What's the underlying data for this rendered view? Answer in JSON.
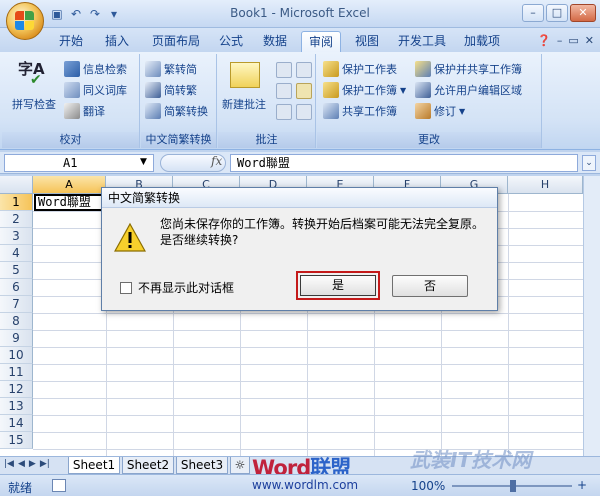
{
  "window": {
    "title": "Book1 - Microsoft Excel"
  },
  "tabs": [
    "开始",
    "插入",
    "页面布局",
    "公式",
    "数据",
    "审阅",
    "视图",
    "开发工具",
    "加载项"
  ],
  "active_tab": "审阅",
  "ribbon": {
    "proofing": {
      "label": "校对",
      "spell": "拼写检查",
      "spell_glyph": "字A",
      "research": "信息检索",
      "thesaurus": "同义词库",
      "translate": "翻译"
    },
    "chinese": {
      "label": "中文简繁转换",
      "to_simplified": "繁转简",
      "to_traditional": "简转繁",
      "convert": "简繁转换"
    },
    "comments": {
      "label": "批注",
      "new": "新建批注"
    },
    "changes": {
      "label": "更改",
      "protect_sheet": "保护工作表",
      "protect_workbook": "保护工作簿",
      "share_workbook": "共享工作簿",
      "protect_share": "保护并共享工作簿",
      "allow_edit": "允许用户编辑区域",
      "track": "修订"
    }
  },
  "formula_bar": {
    "name": "A1",
    "fx": "fx",
    "content": "Word聯盟"
  },
  "columns": [
    "A",
    "B",
    "C",
    "D",
    "E",
    "F",
    "G",
    "H"
  ],
  "rows": [
    "1",
    "2",
    "3",
    "4",
    "5",
    "6",
    "7",
    "8",
    "9",
    "10",
    "11",
    "12",
    "13",
    "14",
    "15"
  ],
  "cell_a1": "Word聯盟",
  "sheets": [
    "Sheet1",
    "Sheet2",
    "Sheet3"
  ],
  "status": {
    "ready": "就绪",
    "zoom": "100%",
    "url": "www.wordlm.com",
    "plus": "+"
  },
  "watermark": {
    "word_red": "Word",
    "word_blue": "联盟",
    "site": "武装IT技术网"
  },
  "dialog": {
    "title": "中文简繁转换",
    "message": "您尚未保存你的工作簿。转换开始后档案可能无法完全复原。是否继续转换?",
    "checkbox": "不再显示此对话框",
    "yes": "是",
    "no": "否"
  }
}
